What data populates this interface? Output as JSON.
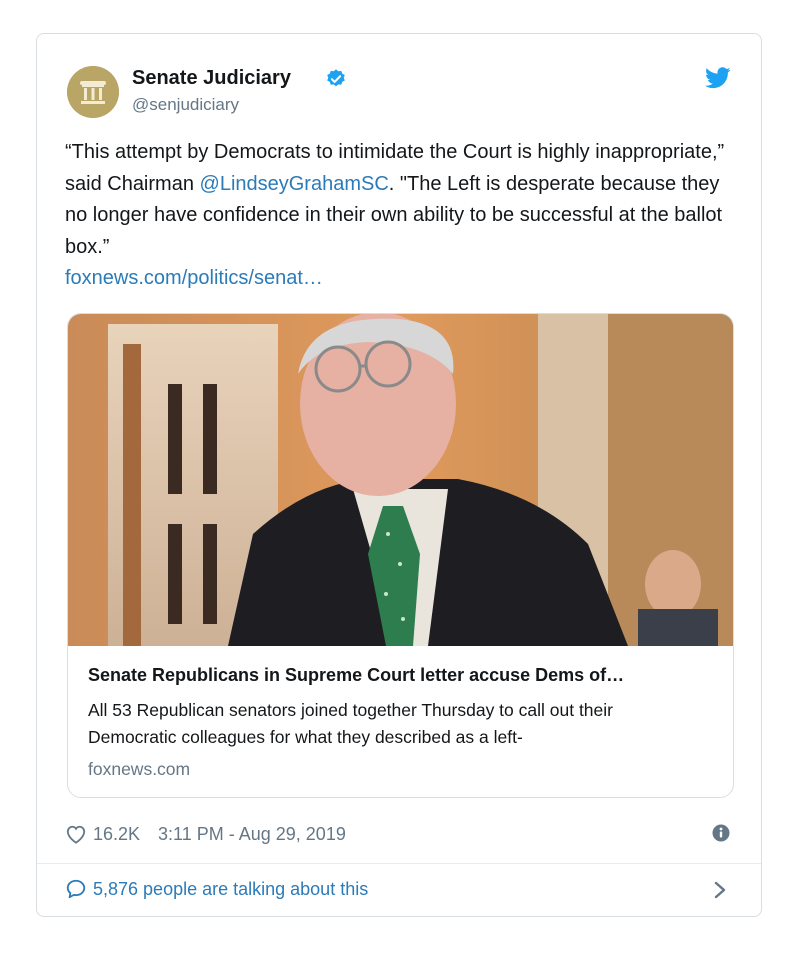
{
  "account": {
    "name": "Senate Judiciary",
    "handle": "@senjudiciary",
    "verified_icon": "verified-badge-icon",
    "platform_icon": "twitter-bird-icon"
  },
  "tweet": {
    "text_part1": "“This attempt by Democrats to intimidate the Court is highly inappropriate,” said Chairman ",
    "mention": "@LindseyGrahamSC",
    "text_part2": ". \"The Left is desperate because they no longer have confidence in their own ability to be successful at the ballot box.”",
    "url": "foxnews.com/politics/senat…"
  },
  "card": {
    "title": "Senate Republicans in Supreme Court letter accuse Dems of…",
    "description": "All 53 Republican senators joined together Thursday to call out their Democratic colleagues for what they described as a left-",
    "domain": "foxnews.com"
  },
  "footer": {
    "likes": "16.2K",
    "timestamp": "3:11 PM - Aug 29, 2019",
    "talking": "5,876 people are talking about this"
  },
  "colors": {
    "link": "#2b7bb9",
    "secondary_text": "#657786",
    "twitter_blue": "#1da1f2",
    "avatar_gold": "#b9a566"
  }
}
